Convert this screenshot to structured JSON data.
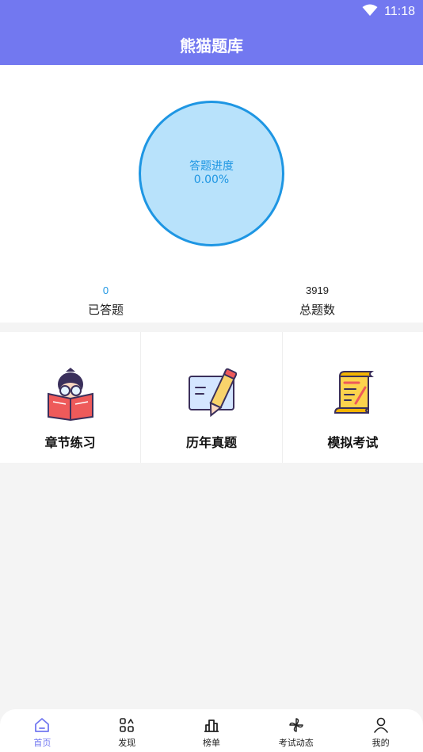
{
  "status_bar": {
    "time": "11:18"
  },
  "header": {
    "title": "熊猫题库"
  },
  "progress": {
    "label": "答题进度",
    "value": "0.00%"
  },
  "stats": [
    {
      "value": "0",
      "label": "已答题"
    },
    {
      "value": "3919",
      "label": "总题数"
    }
  ],
  "features": [
    {
      "label": "章节练习",
      "icon": "reading-student-icon"
    },
    {
      "label": "历年真题",
      "icon": "pencil-paper-icon"
    },
    {
      "label": "模拟考试",
      "icon": "scroll-icon"
    }
  ],
  "nav": {
    "items": [
      {
        "label": "首页",
        "icon": "home-icon",
        "active": true
      },
      {
        "label": "发现",
        "icon": "discover-icon"
      },
      {
        "label": "榜单",
        "icon": "ranking-icon"
      },
      {
        "label": "考试动态",
        "icon": "pinwheel-icon"
      },
      {
        "label": "我的",
        "icon": "profile-icon"
      }
    ]
  },
  "colors": {
    "brand": "#7278f0",
    "progress_fill": "#b8e2fb",
    "progress_stroke": "#1e96e3",
    "background": "#f4f4f4"
  }
}
